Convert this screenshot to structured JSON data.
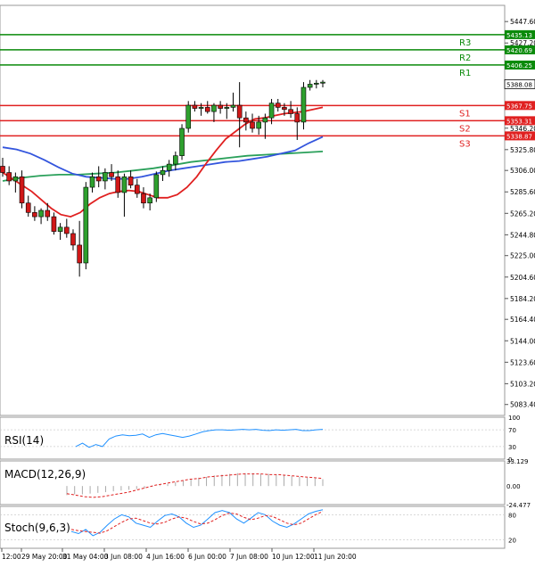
{
  "chart_data": {
    "type": "candlestick",
    "main": {
      "ylim": [
        5073,
        5463
      ],
      "y_ticks": [
        "5447.60",
        "5427.20",
        "5406.80",
        "5388.08",
        "5367.75",
        "5346.20",
        "5325.80",
        "5306.00",
        "5285.60",
        "5265.20",
        "5244.80",
        "5225.00",
        "5204.60",
        "5184.20",
        "5164.40",
        "5144.00",
        "5123.60",
        "5103.20",
        "5083.40"
      ],
      "levels": [
        {
          "name": "R3",
          "value": 5435.13,
          "label": "5435.13",
          "color": "#0a8a0a"
        },
        {
          "name": "R2",
          "value": 5420.69,
          "label": "5420.69",
          "color": "#0a8a0a"
        },
        {
          "name": "R1",
          "value": 5406.25,
          "label": "5406.25",
          "color": "#0a8a0a"
        },
        {
          "name": "S1",
          "value": 5367.75,
          "label": "5367.75",
          "color": "#e02020"
        },
        {
          "name": "S2",
          "value": 5353.31,
          "label": "5353.31",
          "color": "#e02020"
        },
        {
          "name": "S3",
          "value": 5338.87,
          "label": "5338.87",
          "color": "#e02020"
        }
      ],
      "current_price": "5388.08",
      "candles": [
        [
          5310,
          5318,
          5300,
          5304
        ],
        [
          5304,
          5310,
          5292,
          5296
        ],
        [
          5296,
          5304,
          5285,
          5300
        ],
        [
          5300,
          5306,
          5270,
          5275
        ],
        [
          5275,
          5282,
          5262,
          5266
        ],
        [
          5266,
          5272,
          5258,
          5262
        ],
        [
          5262,
          5270,
          5255,
          5268
        ],
        [
          5268,
          5275,
          5258,
          5262
        ],
        [
          5262,
          5266,
          5245,
          5248
        ],
        [
          5248,
          5256,
          5240,
          5252
        ],
        [
          5252,
          5260,
          5242,
          5246
        ],
        [
          5246,
          5250,
          5230,
          5235
        ],
        [
          5235,
          5258,
          5205,
          5218
        ],
        [
          5218,
          5295,
          5212,
          5290
        ],
        [
          5290,
          5304,
          5285,
          5300
        ],
        [
          5300,
          5310,
          5290,
          5296
        ],
        [
          5296,
          5308,
          5288,
          5304
        ],
        [
          5304,
          5312,
          5296,
          5300
        ],
        [
          5300,
          5306,
          5280,
          5285
        ],
        [
          5285,
          5303,
          5262,
          5300
        ],
        [
          5300,
          5306,
          5289,
          5292
        ],
        [
          5292,
          5298,
          5280,
          5284
        ],
        [
          5284,
          5290,
          5270,
          5275
        ],
        [
          5275,
          5284,
          5268,
          5280
        ],
        [
          5280,
          5305,
          5276,
          5302
        ],
        [
          5302,
          5310,
          5296,
          5306
        ],
        [
          5306,
          5316,
          5300,
          5312
        ],
        [
          5312,
          5324,
          5306,
          5320
        ],
        [
          5320,
          5350,
          5316,
          5346
        ],
        [
          5346,
          5372,
          5342,
          5368
        ],
        [
          5368,
          5372,
          5362,
          5365
        ],
        [
          5365,
          5370,
          5358,
          5366
        ],
        [
          5366,
          5372,
          5360,
          5362
        ],
        [
          5362,
          5370,
          5352,
          5368
        ],
        [
          5368,
          5372,
          5360,
          5365
        ],
        [
          5365,
          5370,
          5355,
          5366
        ],
        [
          5366,
          5380,
          5362,
          5368
        ],
        [
          5368,
          5390,
          5328,
          5356
        ],
        [
          5356,
          5362,
          5344,
          5352
        ],
        [
          5352,
          5360,
          5342,
          5346
        ],
        [
          5346,
          5358,
          5340,
          5352
        ],
        [
          5352,
          5360,
          5336,
          5356
        ],
        [
          5356,
          5374,
          5350,
          5370
        ],
        [
          5370,
          5374,
          5362,
          5366
        ],
        [
          5366,
          5370,
          5358,
          5364
        ],
        [
          5364,
          5372,
          5356,
          5360
        ],
        [
          5360,
          5366,
          5335,
          5352
        ],
        [
          5352,
          5390,
          5345,
          5385
        ],
        [
          5385,
          5392,
          5382,
          5388
        ],
        [
          5388,
          5392,
          5384,
          5389
        ],
        [
          5389,
          5392,
          5385,
          5390
        ]
      ],
      "ma_red": [
        5304,
        5298,
        5292,
        5286,
        5278,
        5270,
        5264,
        5262,
        5266,
        5274,
        5280,
        5284,
        5286,
        5287,
        5286,
        5283,
        5280,
        5280,
        5283,
        5290,
        5300,
        5313,
        5325,
        5336,
        5343,
        5350,
        5355,
        5356,
        5358,
        5360,
        5361,
        5362,
        5364,
        5366
      ],
      "ma_blue": [
        5328,
        5326,
        5322,
        5316,
        5309,
        5303,
        5300,
        5299,
        5298,
        5298,
        5300,
        5303,
        5306,
        5308,
        5310,
        5312,
        5314,
        5315,
        5317,
        5319,
        5322,
        5325,
        5332,
        5338
      ],
      "ma_green": [
        5296,
        5299,
        5301,
        5302,
        5302,
        5303,
        5304,
        5306,
        5308,
        5311,
        5314,
        5316,
        5318,
        5320,
        5321,
        5322,
        5323,
        5324
      ]
    },
    "rsi": {
      "label": "RSI(14)",
      "y_ticks": [
        "100",
        "70",
        "30",
        "0"
      ],
      "values": [
        30,
        38,
        28,
        35,
        30,
        48,
        55,
        58,
        56,
        57,
        60,
        52,
        58,
        61,
        58,
        55,
        52,
        55,
        60,
        65,
        68,
        70,
        70,
        69,
        70,
        71,
        70,
        71,
        69,
        68,
        70,
        69,
        70,
        71,
        68,
        68,
        70,
        71
      ]
    },
    "macd": {
      "label": "MACD(12,26,9)",
      "y_ticks": [
        "33.129",
        "0.00",
        "-24.477"
      ],
      "hist": [
        -12,
        -11,
        -11,
        -10,
        -9,
        -8,
        -7,
        -6,
        -5,
        -4,
        -3,
        -1,
        1,
        3,
        5,
        7,
        9,
        11,
        12,
        14,
        15,
        16,
        17,
        17,
        17,
        16,
        16,
        15,
        14,
        13,
        12,
        11,
        10,
        9
      ],
      "signal": [
        -10,
        -12,
        -14,
        -15,
        -14,
        -12,
        -10,
        -8,
        -5,
        -2,
        1,
        3,
        5,
        7,
        9,
        10,
        12,
        13,
        14,
        15,
        16,
        16,
        16,
        15,
        15,
        14,
        13,
        12,
        11,
        10
      ]
    },
    "stoch": {
      "label": "Stoch(9,6,3)",
      "y_ticks": [
        "80",
        "20"
      ],
      "k": [
        40,
        35,
        45,
        30,
        38,
        55,
        70,
        80,
        75,
        60,
        55,
        50,
        65,
        78,
        82,
        75,
        60,
        50,
        55,
        70,
        85,
        90,
        85,
        70,
        60,
        72,
        85,
        80,
        65,
        55,
        50,
        58,
        70,
        82,
        88,
        92
      ],
      "d": [
        45,
        42,
        40,
        38,
        36,
        42,
        52,
        62,
        70,
        72,
        66,
        60,
        58,
        62,
        70,
        75,
        72,
        64,
        58,
        60,
        68,
        78,
        84,
        82,
        74,
        68,
        72,
        78,
        76,
        68,
        60,
        56,
        60,
        70,
        80,
        88
      ]
    },
    "x_ticks": [
      "12:00",
      "29 May 20:00",
      "31 May 04:00",
      "3 Jun 08:00",
      "4 Jun 16:00",
      "6 Jun 00:00",
      "7 Jun 08:00",
      "10 Jun 12:00",
      "11 Jun 20:00"
    ]
  }
}
